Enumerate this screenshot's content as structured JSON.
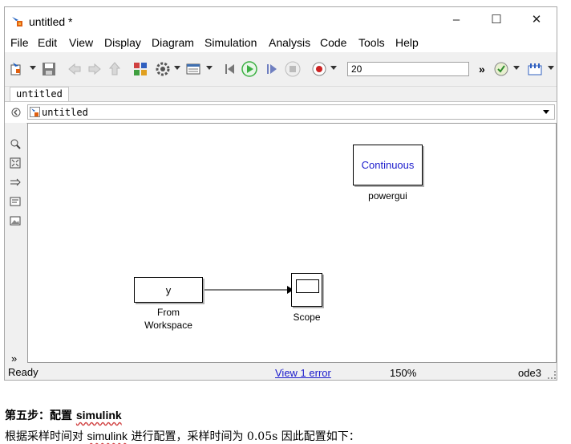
{
  "window": {
    "title": "untitled *",
    "controls": {
      "minimize": "–",
      "maximize": "☐",
      "close": "✕"
    }
  },
  "menu": [
    "File",
    "Edit",
    "View",
    "Display",
    "Diagram",
    "Simulation",
    "Analysis",
    "Code",
    "Tools",
    "Help"
  ],
  "toolbar": {
    "stop_time": "20",
    "more": "»",
    "icons": [
      "new-model-icon",
      "save-icon",
      "back-icon",
      "forward-icon",
      "up-icon",
      "library-browser-icon",
      "model-settings-icon",
      "model-explorer-icon",
      "step-back-icon",
      "run-icon",
      "step-forward-icon",
      "stop-icon",
      "record-icon",
      "model-advisor-icon",
      "build-icon"
    ]
  },
  "tab": {
    "label": "untitled"
  },
  "address": {
    "path": "untitled"
  },
  "blocks": {
    "powergui": {
      "text": "Continuous",
      "label": "powergui"
    },
    "from_workspace": {
      "text": "y",
      "label_line1": "From",
      "label_line2": "Workspace"
    },
    "scope": {
      "label": "Scope"
    }
  },
  "status": {
    "state": "Ready",
    "errors": "View 1 error",
    "zoom": "150%",
    "solver": "ode3"
  },
  "colors": {
    "link": "#1a1acc",
    "run_green": "#3cb043",
    "record_red": "#cc2222"
  },
  "note": {
    "heading_prefix": "第五步：配置 ",
    "heading_keyword": "simulink",
    "body_prefix": "根据采样时间对 ",
    "body_keyword": "simulink",
    "body_suffix": " 进行配置，采样时间为 0.05s 因此配置如下："
  }
}
